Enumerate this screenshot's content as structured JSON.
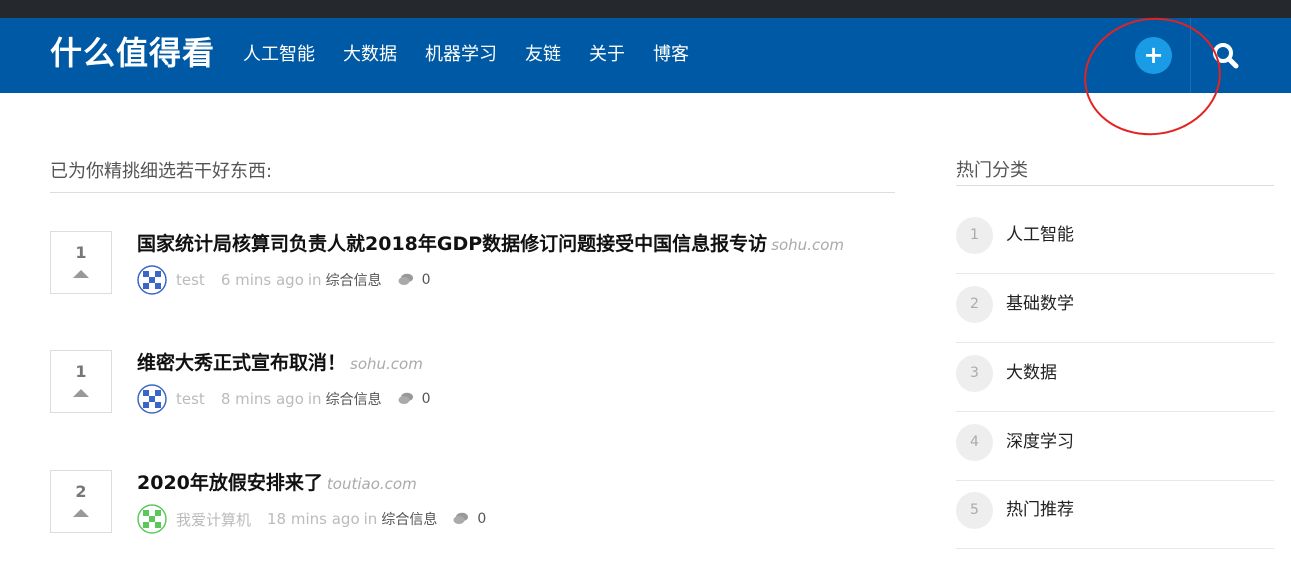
{
  "header": {
    "logo": "什么值得看",
    "nav": [
      "人工智能",
      "大数据",
      "机器学习",
      "友链",
      "关于",
      "博客"
    ],
    "plus_label": "+",
    "brand_color": "#0059a4",
    "accent_color": "#1a9be6"
  },
  "main": {
    "section_title": "已为你精挑细选若干好东西:",
    "posts": [
      {
        "votes": "1",
        "title": "国家统计局核算司负责人就2018年GDP数据修订问题接受中国信息报专访",
        "domain": "sohu.com",
        "author": "test",
        "time": "6 mins ago",
        "in_label": "in",
        "category": "综合信息",
        "comments": "0",
        "avatar_color": "#3b66c7"
      },
      {
        "votes": "1",
        "title": "维密大秀正式宣布取消！",
        "domain": "sohu.com",
        "author": "test",
        "time": "8 mins ago",
        "in_label": "in",
        "category": "综合信息",
        "comments": "0",
        "avatar_color": "#3b66c7"
      },
      {
        "votes": "2",
        "title": "2020年放假安排来了",
        "domain": "toutiao.com",
        "author": "我爱计算机",
        "time": "18 mins ago",
        "in_label": "in",
        "category": "综合信息",
        "comments": "0",
        "avatar_color": "#5cc85c"
      }
    ]
  },
  "sidebar": {
    "title": "热门分类",
    "items": [
      {
        "num": "1",
        "label": "人工智能"
      },
      {
        "num": "2",
        "label": "基础数学"
      },
      {
        "num": "3",
        "label": "大数据"
      },
      {
        "num": "4",
        "label": "深度学习"
      },
      {
        "num": "5",
        "label": "热门推荐"
      }
    ]
  }
}
